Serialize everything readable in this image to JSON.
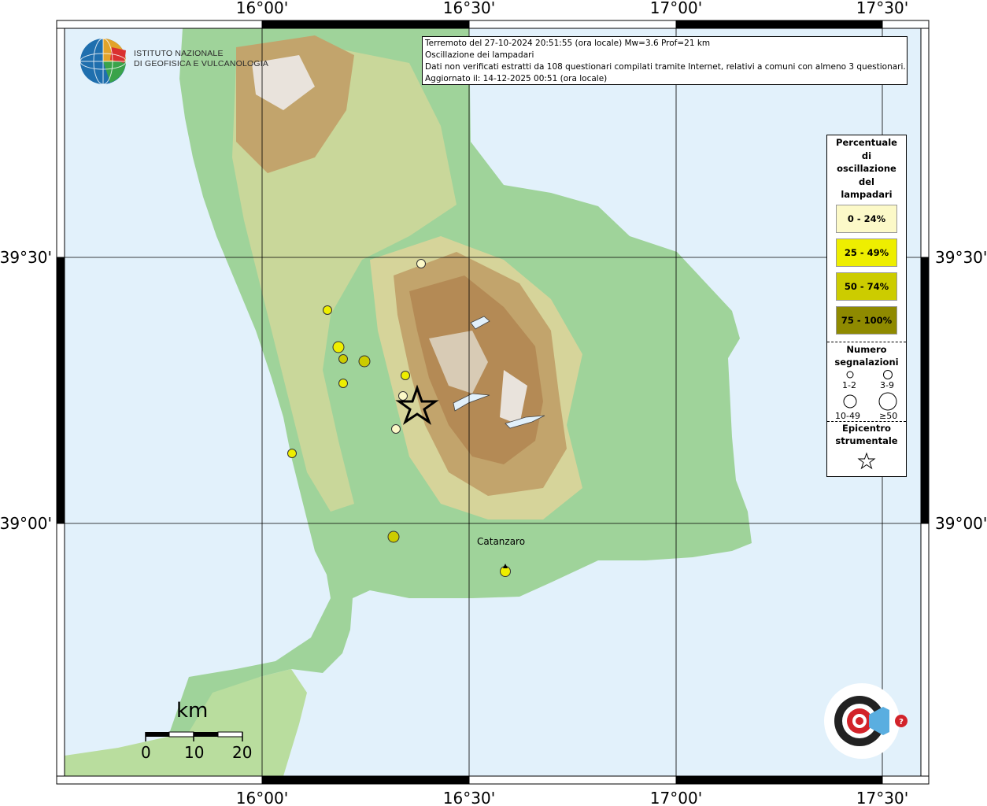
{
  "header": {
    "line1": "Terremoto del 27-10-2024 20:51:55 (ora locale) Mw=3.6 Prof=21 km",
    "line2": "Oscillazione dei lampadari",
    "line3": "Dati non verificati estratti da 108 questionari compilati tramite Internet, relativi a comuni con almeno 3 questionari.",
    "line4": "Aggiornato il: 14-12-2025 00:51 (ora locale)"
  },
  "institute": {
    "line1": "ISTITUTO NAZIONALE",
    "line2": "DI GEOFISICA E VULCANOLOGIA"
  },
  "axes": {
    "lon_labels": [
      "16°00'",
      "16°30'",
      "17°00'",
      "17°30'"
    ],
    "lat_labels": [
      "39°30'",
      "39°00'"
    ]
  },
  "legend": {
    "title_lines": [
      "Percentuale",
      "di",
      "oscillazione",
      "del",
      "lampadari"
    ],
    "classes": [
      {
        "label": "0 - 24%",
        "color": "#fcf9c8"
      },
      {
        "label": "25 - 49%",
        "color": "#eeee00"
      },
      {
        "label": "50 - 74%",
        "color": "#cccc00"
      },
      {
        "label": "75 - 100%",
        "color": "#8f8a00"
      }
    ],
    "count_title_lines": [
      "Numero",
      "segnalazioni"
    ],
    "count_labels": [
      "1-2",
      "3-9",
      "10-49",
      "≥50"
    ],
    "epicenter_title_lines": [
      "Epicentro",
      "strumentale"
    ]
  },
  "scale_bar": {
    "unit": "km",
    "ticks": [
      "0",
      "10",
      "20"
    ]
  },
  "city": "Catanzaro",
  "colors": {
    "sea": "#e2f1fb",
    "lowland": "#9fd39a",
    "hills": "#d6d49a",
    "mountain": "#b48a55",
    "peak": "#e9e3dc"
  }
}
